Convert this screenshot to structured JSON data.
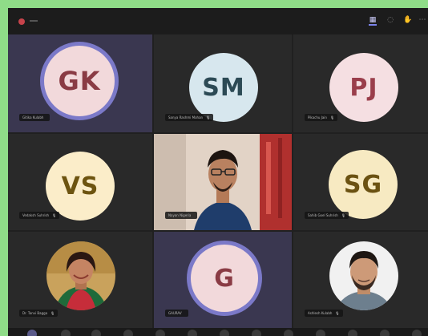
{
  "participants": [
    {
      "initials": "GK",
      "name": "Gitika Kulabh",
      "bg": "#f2d9db",
      "fg": "#8a3b44",
      "mic": ""
    },
    {
      "initials": "SM",
      "name": "Sanya Rashmi Mohan",
      "bg": "#d7e7ee",
      "fg": "#2c4a55",
      "mic": "🎙"
    },
    {
      "initials": "PJ",
      "name": "Pikachu Jain",
      "bg": "#f5dfe2",
      "fg": "#9a3e4b",
      "mic": "🎙"
    },
    {
      "initials": "VS",
      "name": "Vedaksh Suhrish",
      "bg": "#fbedc9",
      "fg": "#6d5410",
      "mic": "🎙"
    },
    {
      "name": "Nayan Nigeria",
      "mic": ""
    },
    {
      "initials": "SG",
      "name": "Sahib Goel Suhrish",
      "bg": "#f7eac2",
      "fg": "#6b5212",
      "mic": "🎙"
    },
    {
      "name": "Dr. Tanvi Bagga",
      "mic": "🎙"
    },
    {
      "initials": "G",
      "name": "GAURAV",
      "bg": "#f2d9db",
      "fg": "#8a3b44",
      "mic": ""
    },
    {
      "name": "Ashlesh Kulabh",
      "mic": "🎙"
    }
  ]
}
